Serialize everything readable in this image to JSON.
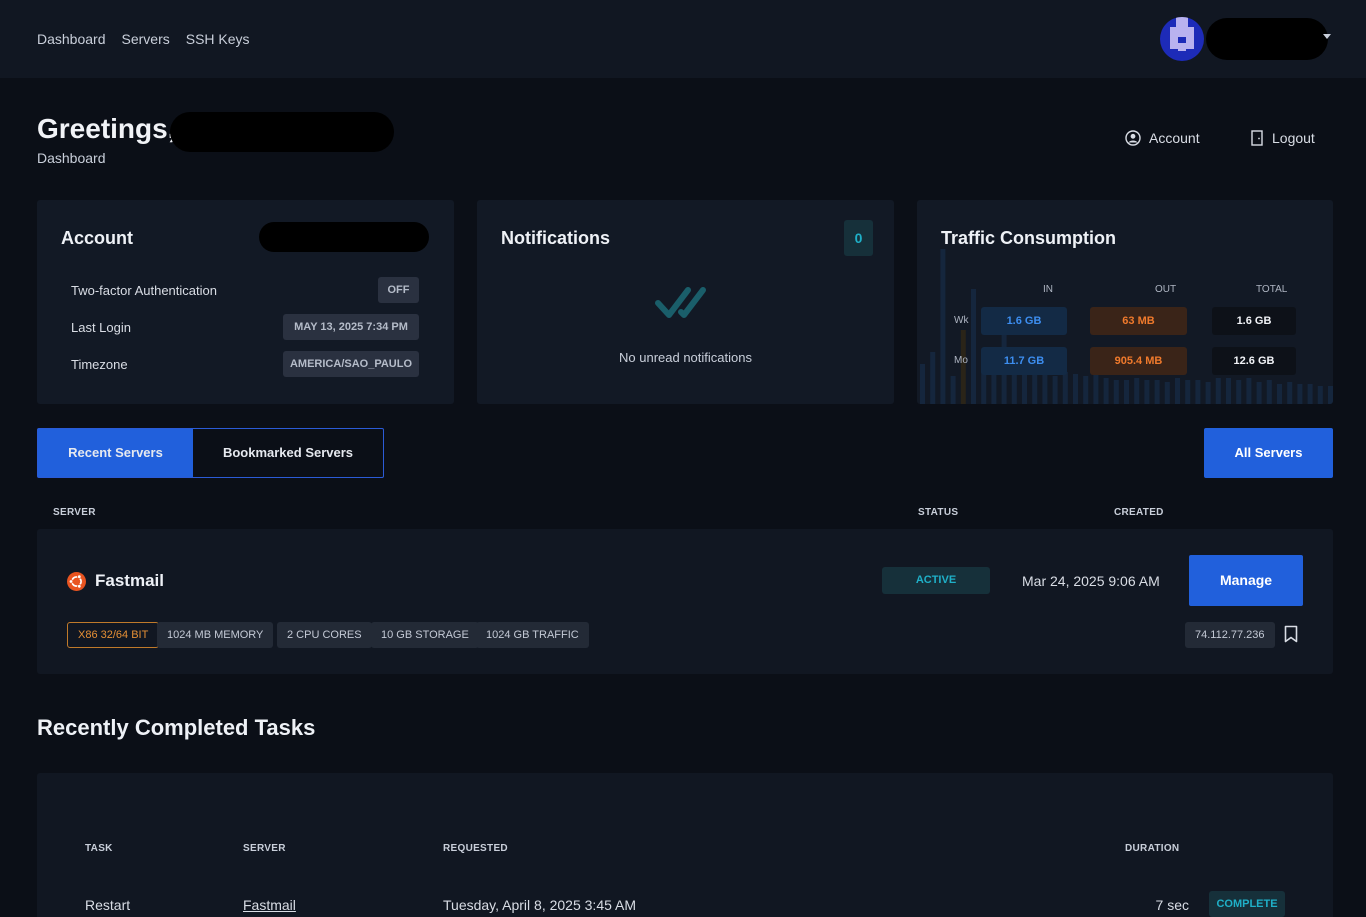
{
  "nav": {
    "links": [
      "Dashboard",
      "Servers",
      "SSH Keys"
    ]
  },
  "header": {
    "greeting": "Greetings,",
    "subtitle": "Dashboard",
    "account_link": "Account",
    "logout_link": "Logout"
  },
  "account_card": {
    "title": "Account",
    "rows": [
      {
        "label": "Two-factor Authentication",
        "value": "OFF"
      },
      {
        "label": "Last Login",
        "value": "MAY 13, 2025 7:34 PM"
      },
      {
        "label": "Timezone",
        "value": "AMERICA/SAO_PAULO"
      }
    ]
  },
  "notifications_card": {
    "title": "Notifications",
    "count": "0",
    "empty_text": "No unread notifications"
  },
  "traffic_card": {
    "title": "Traffic Consumption",
    "columns": [
      "IN",
      "OUT",
      "TOTAL"
    ],
    "rows": [
      {
        "label": "Wk",
        "in": "1.6 GB",
        "out": "63 MB",
        "total": "1.6 GB"
      },
      {
        "label": "Mo",
        "in": "11.7 GB",
        "out": "905.4 MB",
        "total": "12.6 GB"
      }
    ],
    "colors": {
      "in": "#3d8ef0",
      "out": "#f07a2c"
    }
  },
  "servers": {
    "tabs": [
      "Recent Servers",
      "Bookmarked Servers"
    ],
    "active_tab": "Recent Servers",
    "all_button": "All Servers",
    "columns": [
      "SERVER",
      "STATUS",
      "CREATED"
    ],
    "rows": [
      {
        "name": "Fastmail",
        "status": "ACTIVE",
        "created": "Mar 24, 2025 9:06 AM",
        "manage_label": "Manage",
        "specs": [
          "X86 32/64 BIT",
          "1024 MB MEMORY",
          "2 CPU CORES",
          "10 GB STORAGE",
          "1024 GB TRAFFIC"
        ],
        "ip": "74.112.77.236"
      }
    ]
  },
  "tasks": {
    "title": "Recently Completed Tasks",
    "columns": [
      "TASK",
      "SERVER",
      "REQUESTED",
      "DURATION"
    ],
    "rows": [
      {
        "task": "Restart",
        "server": "Fastmail",
        "requested": "Tuesday, April 8, 2025 3:45 AM",
        "duration": "7 sec",
        "status": "COMPLETE"
      }
    ]
  },
  "colors": {
    "accent": "#2160dc",
    "status_teal": "#1fb0c8",
    "background": "#0b0f17",
    "card": "#121925"
  }
}
